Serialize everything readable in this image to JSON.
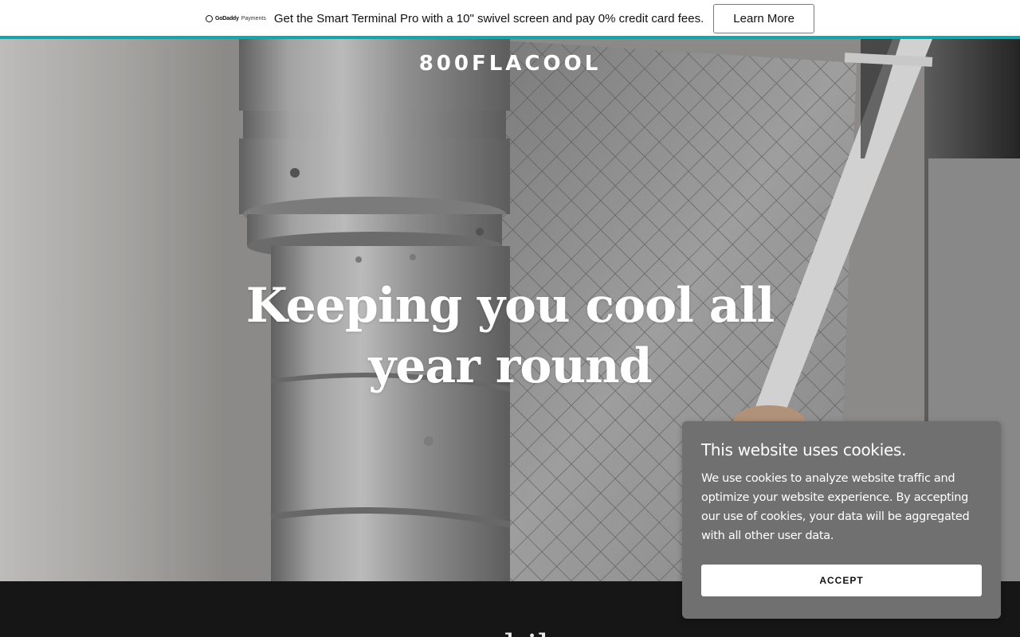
{
  "promo": {
    "brand_name": "GoDaddy",
    "brand_sub": "Payments",
    "text": "Get the Smart Terminal Pro with a 10\" swivel screen and pay 0% credit card fees.",
    "button_label": "Learn More",
    "accent_color": "#1ba3a5"
  },
  "hero": {
    "site_title": "800FLACOOL",
    "headline": "Keeping you cool all year round"
  },
  "section": {
    "heading_partial": "...l  il"
  },
  "cookie": {
    "title": "This website uses cookies.",
    "body": "We use cookies to analyze website traffic and optimize your website experience. By accepting our use of cookies, your data will be aggregated with all other user data.",
    "accept_label": "ACCEPT"
  }
}
